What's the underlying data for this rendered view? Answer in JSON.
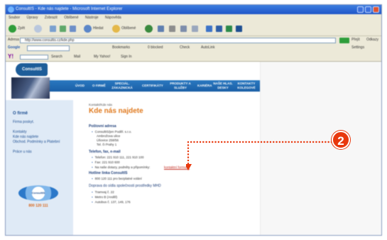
{
  "window": {
    "title": "ConsultIS - Kde nás najdete - Microsoft Internet Explorer"
  },
  "menubar": {
    "items": [
      "Soubor",
      "Úpravy",
      "Zobrazit",
      "Oblíbené",
      "Nástroje",
      "Nápověda"
    ]
  },
  "toolbar": {
    "back_label": "Zpět",
    "search_label": "Hledat",
    "favorites_label": "Oblíbené"
  },
  "addressbar": {
    "label": "Adresa",
    "url": "http://www.consultis.cz/kde.php",
    "go_label": "Přejít",
    "links_label": "Odkazy"
  },
  "googlebar": {
    "label": "Google",
    "bookmarks_label": "Bookmarks",
    "blocked_label": "0 blocked",
    "check_label": "Check",
    "autolink_label": "AutoLink",
    "settings_label": "Settings"
  },
  "linksbar": {
    "search_label": "Search",
    "mail_label": "Mail",
    "my_yahoo_label": "My Yahoo!",
    "sign_in_label": "Sign In"
  },
  "site": {
    "logo_text": "ConsultIS",
    "nav": [
      "ÚVOD",
      "O FIRMĚ",
      "SPECIÁL. ZÁKAZNICKÁ",
      "CERTIFIKÁTY",
      "PRODUKTY A SLUŽBY",
      "KARIÉRA",
      "NAŠE HLAS. DESKY",
      "KONTAKTY KOLEGOVÉ"
    ]
  },
  "sidebar": {
    "title": "O firmě",
    "links": [
      "Firma poskyt.",
      "Kontakty",
      "Kde nás najdete",
      "Obchod. Podmínky a Platební",
      "Práce u nás"
    ],
    "badge_label": "ConsultIS",
    "phone": "800 120 111"
  },
  "main": {
    "breadcrumb": "Kontakt/Kde nás",
    "title": "Kde nás najdete",
    "postal_heading": "Poštovní adresa",
    "postal_lines": [
      "ConsultIS/jen Poděl. s.r.o.",
      "Ambrožova ulice",
      "Úšovice 258/56",
      "Tel. či Prahy 1"
    ],
    "contact_heading": "Telefon, fax, e-mail",
    "contact_lines": [
      "Telefon: 221 910 111, 221 910 100",
      "Fax: 221 910 600",
      "Na naše dotazy, podněty a připomínky:"
    ],
    "contact_form_link": "kontaktní formulář",
    "hotline_heading": "Hotline linka ConsultIS",
    "hotline_lines": [
      "800 120 111 pro bezplatné volání"
    ],
    "transport_heading": "Doprava do sídla společnosti prostředky MHD",
    "transport_lines": [
      "Tramvaj č. 22",
      "Metro B (Anděl)",
      "Autobus č. 137, 149, 176"
    ]
  },
  "callout": {
    "number": "2"
  },
  "colors": {
    "accent": "#e8380d",
    "nav_blue": "#1a5fa6",
    "title_orange": "#e07a1f",
    "sidebar_bg": "#dfeaf6"
  }
}
